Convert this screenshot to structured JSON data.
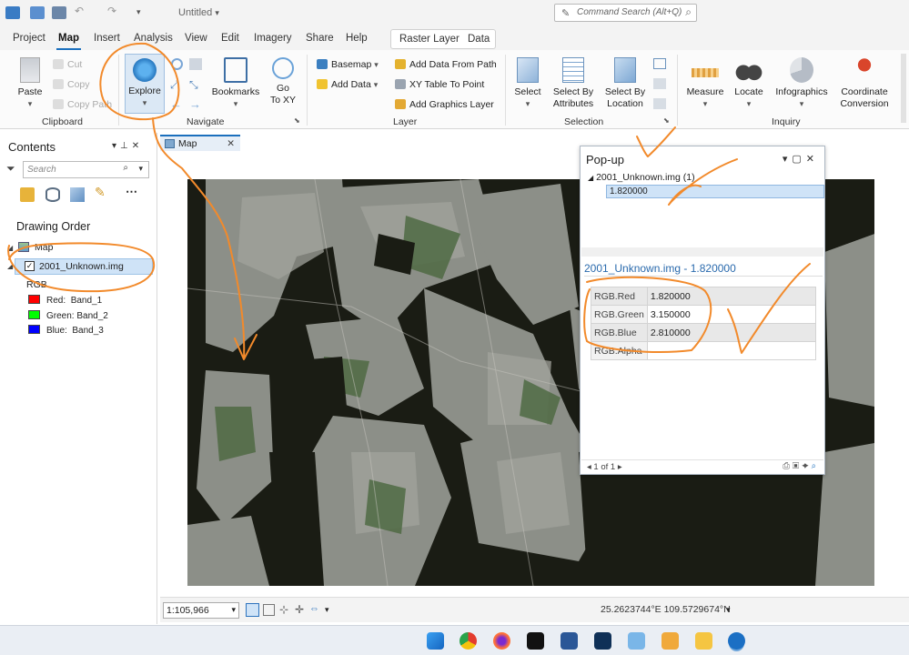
{
  "window": {
    "title": "Untitled",
    "command_search_placeholder": "Command Search (Alt+Q)"
  },
  "menu": {
    "tabs": [
      "Project",
      "Map",
      "Insert",
      "Analysis",
      "View",
      "Edit",
      "Imagery",
      "Share",
      "Help"
    ],
    "active_tab": "Map",
    "contextual_tabs": [
      "Raster Layer",
      "Data"
    ]
  },
  "ribbon": {
    "clipboard": {
      "label": "Clipboard",
      "paste": "Paste",
      "cut": "Cut",
      "copy": "Copy",
      "copy_path": "Copy Path"
    },
    "navigate": {
      "label": "Navigate",
      "explore": "Explore",
      "bookmarks": "Bookmarks",
      "go_to_xy_1": "Go",
      "go_to_xy_2": "To XY"
    },
    "layer": {
      "label": "Layer",
      "basemap": "Basemap",
      "add_data": "Add Data",
      "add_data_from_path": "Add Data From Path",
      "xy_table_to_point": "XY Table To Point",
      "add_graphics_layer": "Add Graphics Layer"
    },
    "selection": {
      "label": "Selection",
      "select": "Select",
      "select_by_attributes_1": "Select By",
      "select_by_attributes_2": "Attributes",
      "select_by_location_1": "Select By",
      "select_by_location_2": "Location"
    },
    "inquiry": {
      "label": "Inquiry",
      "measure": "Measure",
      "locate": "Locate",
      "infographics": "Infographics",
      "coordinate_conversion_1": "Coordinate",
      "coordinate_conversion_2": "Conversion"
    }
  },
  "contents": {
    "title": "Contents",
    "search_placeholder": "Search",
    "drawing_order": "Drawing Order",
    "map_node": "Map",
    "layer_name": "2001_Unknown.img",
    "renderer": "RGB",
    "bands": [
      {
        "label": "Red:",
        "band": "Band_1",
        "color": "#ff0000"
      },
      {
        "label": "Green:",
        "band": "Band_2",
        "color": "#00ff00"
      },
      {
        "label": "Blue:",
        "band": "Band_3",
        "color": "#0000ff"
      }
    ]
  },
  "map_tab": {
    "label": "Map"
  },
  "popup": {
    "title": "Pop-up",
    "layer_entry": "2001_Unknown.img  (1)",
    "selected_value": "1.820000",
    "subtitle": "2001_Unknown.img - 1.820000",
    "rows": [
      {
        "key": "RGB.Red",
        "value": "1.820000"
      },
      {
        "key": "RGB.Green",
        "value": "3.150000"
      },
      {
        "key": "RGB.Blue",
        "value": "2.810000"
      },
      {
        "key": "RGB.Alpha",
        "value": ""
      }
    ],
    "pager": "1 of 1"
  },
  "statusbar": {
    "scale": "1:105,966",
    "coordinates": "25.2623744°E 109.5729674°N"
  },
  "annotation_color": "#f28a2b"
}
